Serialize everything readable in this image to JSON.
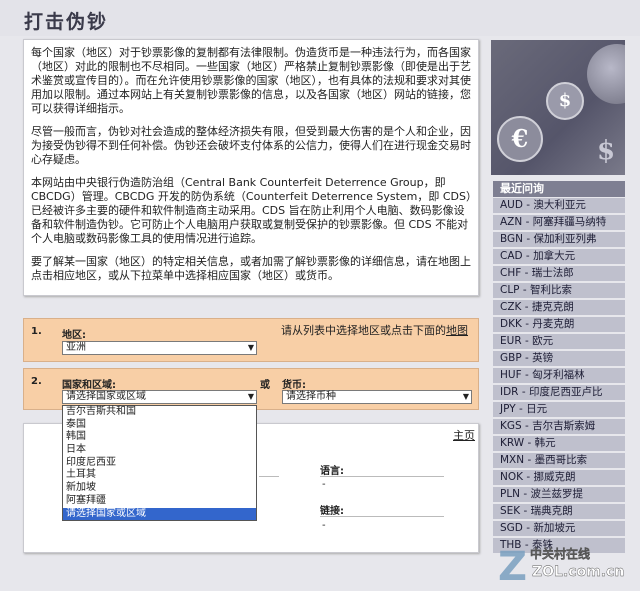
{
  "page": {
    "title": "打击伪钞"
  },
  "intro": {
    "paragraphs": [
      "每个国家（地区）对于钞票影像的复制都有法律限制。伪造货币是一种违法行为，而各国家（地区）对此的限制也不尽相同。一些国家（地区）严格禁止复制钞票影像（即使是出于艺术鉴赏或宣传目的）。而在允许使用钞票影像的国家（地区），也有具体的法规和要求对其使用加以限制。通过本网站上有关复制钞票影像的信息，以及各国家（地区）网站的链接，您可以获得详细指示。",
      "尽管一般而言，伪钞对社会造成的整体经济损失有限，但受到最大伤害的是个人和企业，因为接受伪钞得不到任何补偿。伪钞还会破坏支付体系的公信力，使得人们在进行现金交易时心存疑虑。",
      "本网站由中央银行伪造防治组（Central Bank Counterfeit Deterrence Group，即 CBCDG）管理。CBCDG 开发的防伪系统（Counterfeit Deterrence System，即 CDS）已经被许多主要的硬件和软件制造商主动采用。CDS 旨在防止利用个人电脑、数码影像设备和软件制造伪钞。它可防止个人电脑用户获取或复制受保护的钞票影像。但 CDS 不能对个人电脑或数码影像工具的使用情况进行追踪。",
      "要了解某一国家（地区）的特定相关信息，或者加需了解钞票影像的详细信息，请在地图上点击相应地区，或从下拉菜单中选择相应国家（地区）或货币。"
    ]
  },
  "sidebar": {
    "heading": "最近问询",
    "items": [
      "AUD - 澳大利亚元",
      "AZN - 阿塞拜疆马纳特",
      "BGN - 保加利亚列弗",
      "CAD - 加拿大元",
      "CHF - 瑞士法郎",
      "CLP - 智利比索",
      "CZK - 捷克克朗",
      "DKK - 丹麦克朗",
      "EUR - 欧元",
      "GBP - 英镑",
      "HUF - 匈牙利福林",
      "IDR - 印度尼西亚卢比",
      "JPY - 日元",
      "KGS - 吉尔吉斯索姆",
      "KRW - 韩元",
      "MXN - 墨西哥比索",
      "NOK - 挪威克朗",
      "PLN - 波兰兹罗提",
      "SEK - 瑞典克朗",
      "SGD - 新加坡元",
      "THB - 泰铢"
    ]
  },
  "step1": {
    "num": "1.",
    "region_label": "地区:",
    "region_value": "亚洲",
    "hint": "请从列表中选择地区或点击下面的",
    "hint_link": "地图"
  },
  "step2": {
    "num": "2.",
    "country_label": "国家和区域:",
    "country_value": "请选择国家或区域",
    "or_label": "或",
    "currency_label": "货币:",
    "currency_value": "请选择币种"
  },
  "dropdown": {
    "options": [
      "吉尔吉斯共和国",
      "泰国",
      "韩国",
      "日本",
      "印度尼西亚",
      "土耳其",
      "新加坡",
      "阿塞拜疆",
      "请选择国家或区域"
    ],
    "selected_index": 8
  },
  "panel": {
    "home_link": "主页",
    "language_label": "语言:",
    "language_value": "-",
    "link_label": "链接:",
    "link_value": "-"
  },
  "watermark": {
    "text1": "中关村在线",
    "text2": "ZOL.com.cn"
  }
}
